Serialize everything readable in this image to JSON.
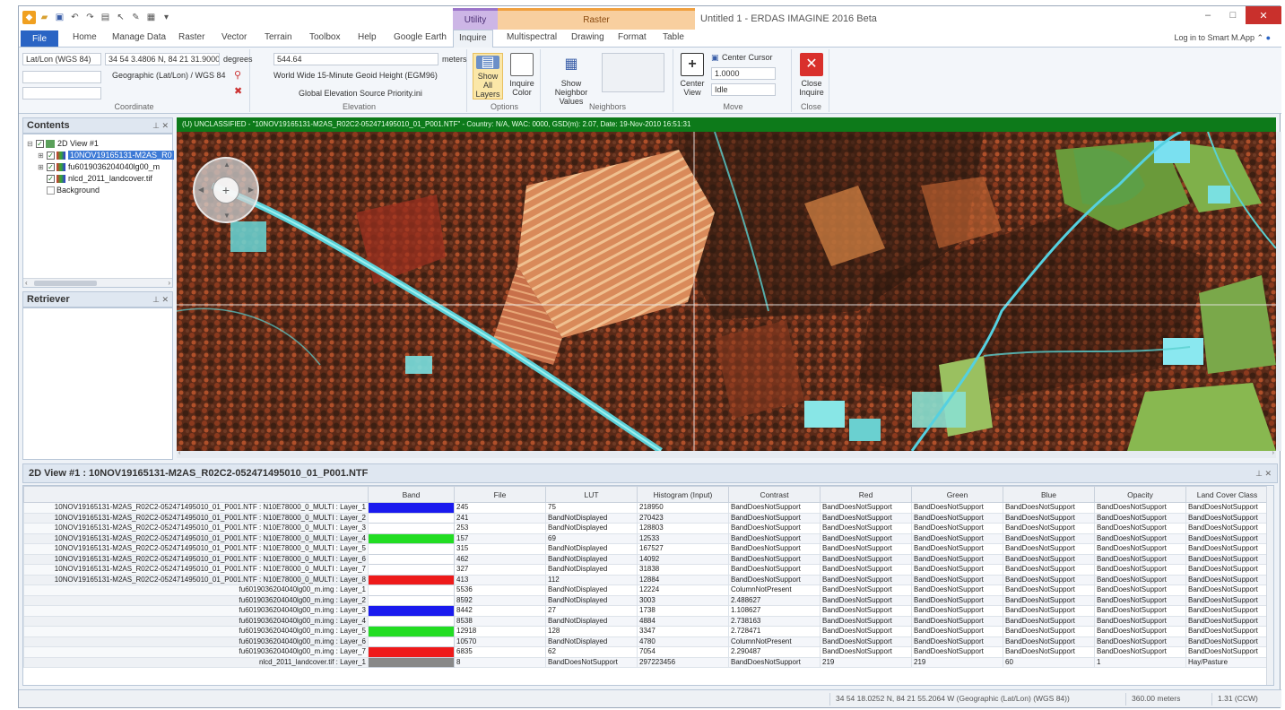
{
  "window": {
    "title": "Untitled 1 - ERDAS IMAGINE 2016 Beta",
    "minimize": "–",
    "maximize": "□",
    "close": "✕"
  },
  "context_tabs": {
    "utility": "Utility",
    "raster": "Raster"
  },
  "ribbon_tabs": [
    "File",
    "Home",
    "Manage Data",
    "Raster",
    "Vector",
    "Terrain",
    "Toolbox",
    "Help",
    "Google Earth",
    "Inquire",
    "Multispectral",
    "Drawing",
    "Format",
    "Table"
  ],
  "active_tab": "Inquire",
  "login": "Log in to Smart M.App",
  "ribbon": {
    "coordinate": {
      "system": "Lat/Lon (WGS 84)",
      "value": "34 54 3.4806 N, 84 21 31.9000 W",
      "units": "degrees",
      "projection": "Geographic (Lat/Lon) / WGS 84",
      "label": "Coordinate"
    },
    "elevation": {
      "value": "544.64",
      "units": "meters",
      "source": "World Wide 15-Minute Geoid Height (EGM96)",
      "source2": "Global Elevation Source Priority.ini",
      "label": "Elevation"
    },
    "options": {
      "show_all_layers": "Show All Layers",
      "inquire_color": "Inquire Color",
      "label": "Options"
    },
    "neighbors": {
      "show_neighbor_values": "Show Neighbor Values",
      "label": "Neighbors"
    },
    "move": {
      "center_view": "Center View",
      "center_cursor": "Center Cursor",
      "scale": "1.0000",
      "mode": "Idle",
      "label": "Move"
    },
    "close": {
      "close_inquire": "Close Inquire",
      "label": "Close"
    }
  },
  "contents": {
    "title": "Contents",
    "items": [
      {
        "label": "2D View #1"
      },
      {
        "label": "10NOV19165131-M2AS_R0"
      },
      {
        "label": "fu6019036204040lg00_m"
      },
      {
        "label": "nlcd_2011_landcover.tif"
      },
      {
        "label": "Background"
      }
    ]
  },
  "retriever": {
    "title": "Retriever"
  },
  "view_bar": "(U) UNCLASSIFIED - \"10NOV19165131-M2AS_R02C2-052471495010_01_P001.NTF\" - Country: N/A, WAC: 0000, GSD(m): 2.07, Date: 19-Nov-2010 16:51:31",
  "attribute_panel": {
    "title": "2D View #1 : 10NOV19165131-M2AS_R02C2-052471495010_01_P001.NTF",
    "columns": [
      "",
      "Band",
      "File",
      "LUT",
      "Histogram (Input)",
      "Contrast",
      "Red",
      "Green",
      "Blue",
      "Opacity",
      "Land Cover Class"
    ],
    "rows": [
      {
        "name": "10NOV19165131-M2AS_R02C2-052471495010_01_P001.NTF : N10E78000_0_MULTI : Layer_1",
        "color": "#1a1aee",
        "file": "245",
        "lut": "75",
        "hist": "218950",
        "contrast": "BandDoesNotSupport",
        "red": "BandDoesNotSupport",
        "green": "BandDoesNotSupport",
        "blue": "BandDoesNotSupport",
        "opacity": "BandDoesNotSupport",
        "class": "BandDoesNotSupport"
      },
      {
        "name": "10NOV19165131-M2AS_R02C2-052471495010_01_P001.NTF : N10E78000_0_MULTI : Layer_2",
        "color": "#ffffff",
        "file": "241",
        "lut": "BandNotDisplayed",
        "hist": "270423",
        "contrast": "BandDoesNotSupport",
        "red": "BandDoesNotSupport",
        "green": "BandDoesNotSupport",
        "blue": "BandDoesNotSupport",
        "opacity": "BandDoesNotSupport",
        "class": "BandDoesNotSupport"
      },
      {
        "name": "10NOV19165131-M2AS_R02C2-052471495010_01_P001.NTF : N10E78000_0_MULTI : Layer_3",
        "color": "#ffffff",
        "file": "253",
        "lut": "BandNotDisplayed",
        "hist": "128803",
        "contrast": "BandDoesNotSupport",
        "red": "BandDoesNotSupport",
        "green": "BandDoesNotSupport",
        "blue": "BandDoesNotSupport",
        "opacity": "BandDoesNotSupport",
        "class": "BandDoesNotSupport"
      },
      {
        "name": "10NOV19165131-M2AS_R02C2-052471495010_01_P001.NTF : N10E78000_0_MULTI : Layer_4",
        "color": "#22dd22",
        "file": "157",
        "lut": "69",
        "hist": "12533",
        "contrast": "BandDoesNotSupport",
        "red": "BandDoesNotSupport",
        "green": "BandDoesNotSupport",
        "blue": "BandDoesNotSupport",
        "opacity": "BandDoesNotSupport",
        "class": "BandDoesNotSupport"
      },
      {
        "name": "10NOV19165131-M2AS_R02C2-052471495010_01_P001.NTF : N10E78000_0_MULTI : Layer_5",
        "color": "#ffffff",
        "file": "315",
        "lut": "BandNotDisplayed",
        "hist": "167527",
        "contrast": "BandDoesNotSupport",
        "red": "BandDoesNotSupport",
        "green": "BandDoesNotSupport",
        "blue": "BandDoesNotSupport",
        "opacity": "BandDoesNotSupport",
        "class": "BandDoesNotSupport"
      },
      {
        "name": "10NOV19165131-M2AS_R02C2-052471495010_01_P001.NTF : N10E78000_0_MULTI : Layer_6",
        "color": "#ffffff",
        "file": "462",
        "lut": "BandNotDisplayed",
        "hist": "14092",
        "contrast": "BandDoesNotSupport",
        "red": "BandDoesNotSupport",
        "green": "BandDoesNotSupport",
        "blue": "BandDoesNotSupport",
        "opacity": "BandDoesNotSupport",
        "class": "BandDoesNotSupport"
      },
      {
        "name": "10NOV19165131-M2AS_R02C2-052471495010_01_P001.NTF : N10E78000_0_MULTI : Layer_7",
        "color": "#ffffff",
        "file": "327",
        "lut": "BandNotDisplayed",
        "hist": "31838",
        "contrast": "BandDoesNotSupport",
        "red": "BandDoesNotSupport",
        "green": "BandDoesNotSupport",
        "blue": "BandDoesNotSupport",
        "opacity": "BandDoesNotSupport",
        "class": "BandDoesNotSupport"
      },
      {
        "name": "10NOV19165131-M2AS_R02C2-052471495010_01_P001.NTF : N10E78000_0_MULTI : Layer_8",
        "color": "#ee1a1a",
        "file": "413",
        "lut": "112",
        "hist": "12884",
        "contrast": "BandDoesNotSupport",
        "red": "BandDoesNotSupport",
        "green": "BandDoesNotSupport",
        "blue": "BandDoesNotSupport",
        "opacity": "BandDoesNotSupport",
        "class": "BandDoesNotSupport"
      },
      {
        "name": "fu6019036204040lg00_m.img : Layer_1",
        "color": "#ffffff",
        "file": "5536",
        "lut": "BandNotDisplayed",
        "hist": "12224",
        "contrast": "ColumnNotPresent",
        "red": "BandDoesNotSupport",
        "green": "BandDoesNotSupport",
        "blue": "BandDoesNotSupport",
        "opacity": "BandDoesNotSupport",
        "class": "BandDoesNotSupport"
      },
      {
        "name": "fu6019036204040lg00_m.img : Layer_2",
        "color": "#ffffff",
        "file": "8592",
        "lut": "BandNotDisplayed",
        "hist": "3003",
        "contrast": "2.488627",
        "red": "BandDoesNotSupport",
        "green": "BandDoesNotSupport",
        "blue": "BandDoesNotSupport",
        "opacity": "BandDoesNotSupport",
        "class": "BandDoesNotSupport"
      },
      {
        "name": "fu6019036204040lg00_m.img : Layer_3",
        "color": "#1a1aee",
        "file": "8442",
        "lut": "27",
        "hist": "1738",
        "contrast": "1.108627",
        "red": "BandDoesNotSupport",
        "green": "BandDoesNotSupport",
        "blue": "BandDoesNotSupport",
        "opacity": "BandDoesNotSupport",
        "class": "BandDoesNotSupport"
      },
      {
        "name": "fu6019036204040lg00_m.img : Layer_4",
        "color": "#ffffff",
        "file": "8538",
        "lut": "BandNotDisplayed",
        "hist": "4884",
        "contrast": "2.738163",
        "red": "BandDoesNotSupport",
        "green": "BandDoesNotSupport",
        "blue": "BandDoesNotSupport",
        "opacity": "BandDoesNotSupport",
        "class": "BandDoesNotSupport"
      },
      {
        "name": "fu6019036204040lg00_m.img : Layer_5",
        "color": "#22dd22",
        "file": "12918",
        "lut": "128",
        "hist": "3347",
        "contrast": "2.728471",
        "red": "BandDoesNotSupport",
        "green": "BandDoesNotSupport",
        "blue": "BandDoesNotSupport",
        "opacity": "BandDoesNotSupport",
        "class": "BandDoesNotSupport"
      },
      {
        "name": "fu6019036204040lg00_m.img : Layer_6",
        "color": "#ffffff",
        "file": "10570",
        "lut": "BandNotDisplayed",
        "hist": "4780",
        "contrast": "ColumnNotPresent",
        "red": "BandDoesNotSupport",
        "green": "BandDoesNotSupport",
        "blue": "BandDoesNotSupport",
        "opacity": "BandDoesNotSupport",
        "class": "BandDoesNotSupport"
      },
      {
        "name": "fu6019036204040lg00_m.img : Layer_7",
        "color": "#ee1a1a",
        "file": "6835",
        "lut": "62",
        "hist": "7054",
        "contrast": "2.290487",
        "red": "BandDoesNotSupport",
        "green": "BandDoesNotSupport",
        "blue": "BandDoesNotSupport",
        "opacity": "BandDoesNotSupport",
        "class": "BandDoesNotSupport"
      },
      {
        "name": "nlcd_2011_landcover.tif : Layer_1",
        "color": "#888888",
        "file": "8",
        "lut": "BandDoesNotSupport",
        "hist": "297223456",
        "contrast": "BandDoesNotSupport",
        "red": "219",
        "green": "219",
        "blue": "60",
        "opacity": "1",
        "class": "Hay/Pasture"
      }
    ]
  },
  "status": {
    "coordinates": "34 54 18.0252 N, 84 21 55.2064 W (Geographic (Lat/Lon) (WGS 84))",
    "scale": "360.00 meters",
    "rotation": "1.31 (CCW)"
  }
}
